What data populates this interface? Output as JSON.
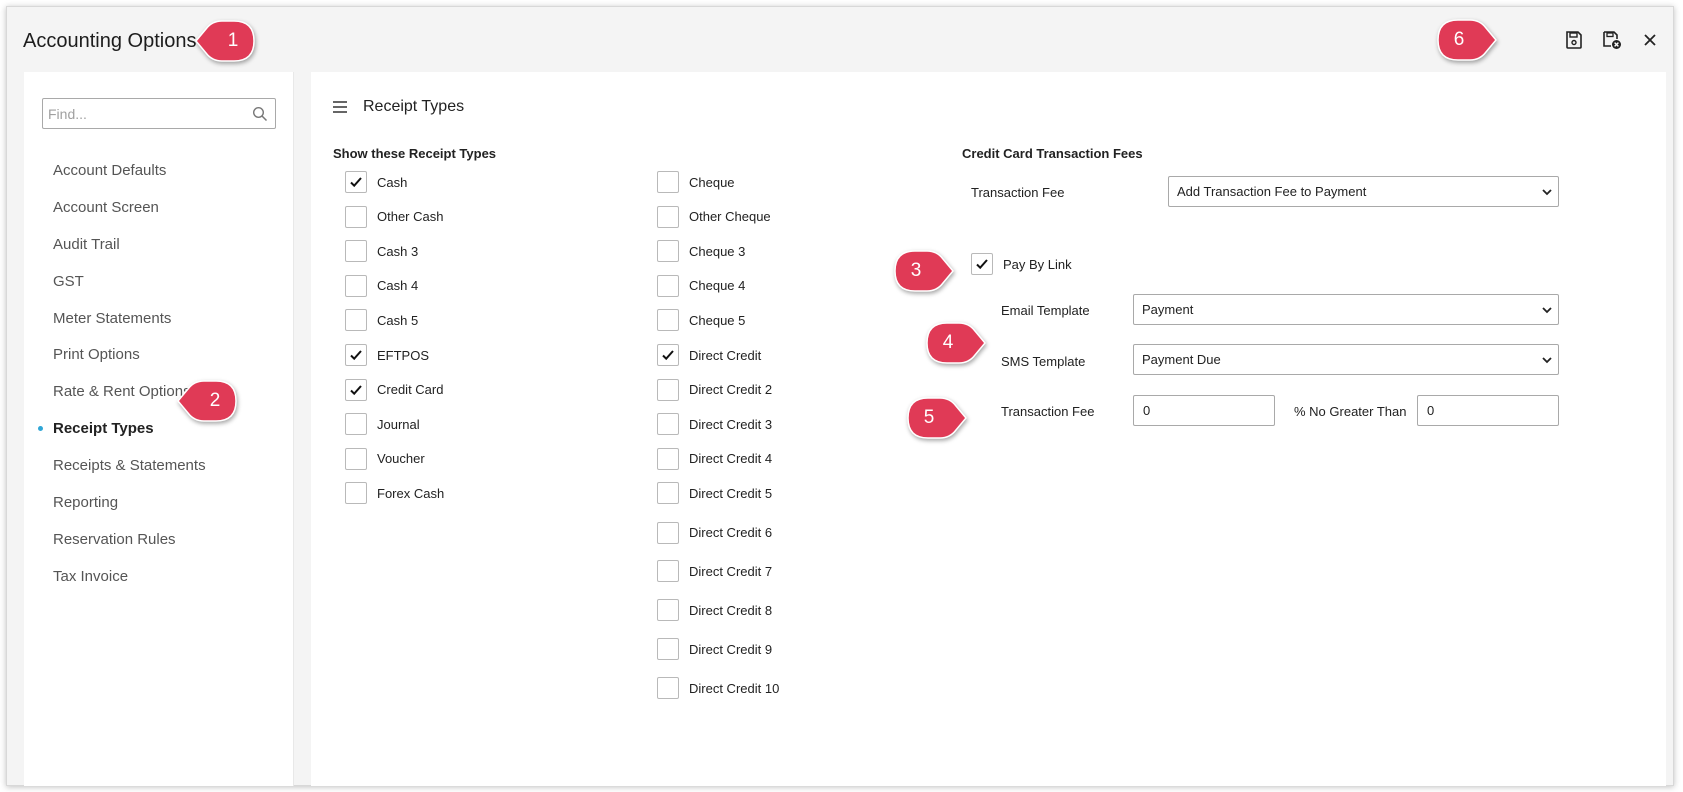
{
  "window": {
    "title": "Accounting Options"
  },
  "toolbar": {
    "save_icon": "save-icon",
    "save_close_icon": "save-close-icon",
    "close_icon": "close-icon"
  },
  "sidebar": {
    "search_placeholder": "Find...",
    "search_icon": "search-icon",
    "items": [
      {
        "label": "Account Defaults",
        "active": false
      },
      {
        "label": "Account Screen",
        "active": false
      },
      {
        "label": "Audit Trail",
        "active": false
      },
      {
        "label": "GST",
        "active": false
      },
      {
        "label": "Meter Statements",
        "active": false
      },
      {
        "label": "Print Options",
        "active": false
      },
      {
        "label": "Rate & Rent Options",
        "active": false
      },
      {
        "label": "Receipt Types",
        "active": true
      },
      {
        "label": "Receipts & Statements",
        "active": false
      },
      {
        "label": "Reporting",
        "active": false
      },
      {
        "label": "Reservation Rules",
        "active": false
      },
      {
        "label": "Tax Invoice",
        "active": false
      }
    ]
  },
  "main": {
    "title": "Receipt Types",
    "receipt_section_label": "Show these Receipt Types",
    "left_column": [
      {
        "label": "Cash",
        "checked": true
      },
      {
        "label": "Other Cash",
        "checked": false
      },
      {
        "label": "Cash 3",
        "checked": false
      },
      {
        "label": "Cash 4",
        "checked": false
      },
      {
        "label": "Cash 5",
        "checked": false
      },
      {
        "label": "EFTPOS",
        "checked": true
      },
      {
        "label": "Credit Card",
        "checked": true
      },
      {
        "label": "Journal",
        "checked": false
      },
      {
        "label": "Voucher",
        "checked": false
      },
      {
        "label": "Forex Cash",
        "checked": false
      }
    ],
    "right_column": [
      {
        "label": "Cheque",
        "checked": false
      },
      {
        "label": "Other Cheque",
        "checked": false
      },
      {
        "label": "Cheque 3",
        "checked": false
      },
      {
        "label": "Cheque 4",
        "checked": false
      },
      {
        "label": "Cheque 5",
        "checked": false
      },
      {
        "label": "Direct Credit",
        "checked": true
      },
      {
        "label": "Direct Credit 2",
        "checked": false
      },
      {
        "label": "Direct Credit 3",
        "checked": false
      },
      {
        "label": "Direct Credit 4",
        "checked": false
      },
      {
        "label": "Direct Credit 5",
        "checked": false
      },
      {
        "label": "Direct Credit 6",
        "checked": false
      },
      {
        "label": "Direct Credit 7",
        "checked": false
      },
      {
        "label": "Direct Credit 8",
        "checked": false
      },
      {
        "label": "Direct Credit 9",
        "checked": false
      },
      {
        "label": "Direct Credit 10",
        "checked": false
      }
    ],
    "cc": {
      "section_label": "Credit Card Transaction Fees",
      "transaction_fee_label": "Transaction Fee",
      "transaction_fee_value": "Add Transaction Fee to Payment",
      "pay_by_link_label": "Pay By Link",
      "pay_by_link_checked": true,
      "email_template_label": "Email Template",
      "email_template_value": "Payment",
      "sms_template_label": "SMS Template",
      "sms_template_value": "Payment Due",
      "link_fee_label": "Transaction Fee",
      "link_fee_value": "0",
      "no_greater_label": "% No Greater Than",
      "no_greater_value": "0"
    }
  },
  "callouts": [
    "1",
    "2",
    "3",
    "4",
    "5",
    "6"
  ],
  "colors": {
    "callout": "#e03a56",
    "active_dot": "#2fa6d6"
  }
}
